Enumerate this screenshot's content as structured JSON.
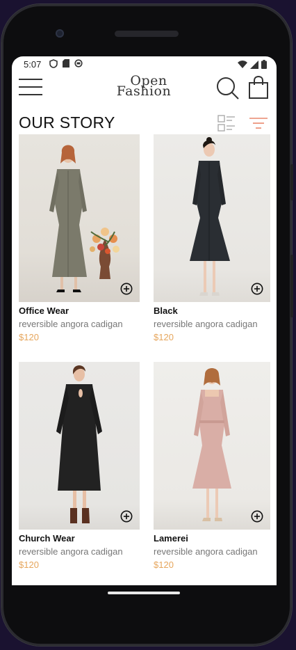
{
  "status_bar": {
    "time": "5:07"
  },
  "header": {
    "logo_line1": "Open",
    "logo_line2": "Fashion"
  },
  "section": {
    "title": "OUR STORY"
  },
  "products": [
    {
      "name": "Office Wear",
      "description": "reversible angora cadigan",
      "price": "$120"
    },
    {
      "name": "Black",
      "description": "reversible angora cadigan",
      "price": "$120"
    },
    {
      "name": "Church Wear",
      "description": "reversible angora cadigan",
      "price": "$120"
    },
    {
      "name": "Lamerei",
      "description": "reversible angora cadigan",
      "price": "$120"
    }
  ],
  "colors": {
    "accent": "#e6a65d",
    "filter": "#e9876d"
  }
}
